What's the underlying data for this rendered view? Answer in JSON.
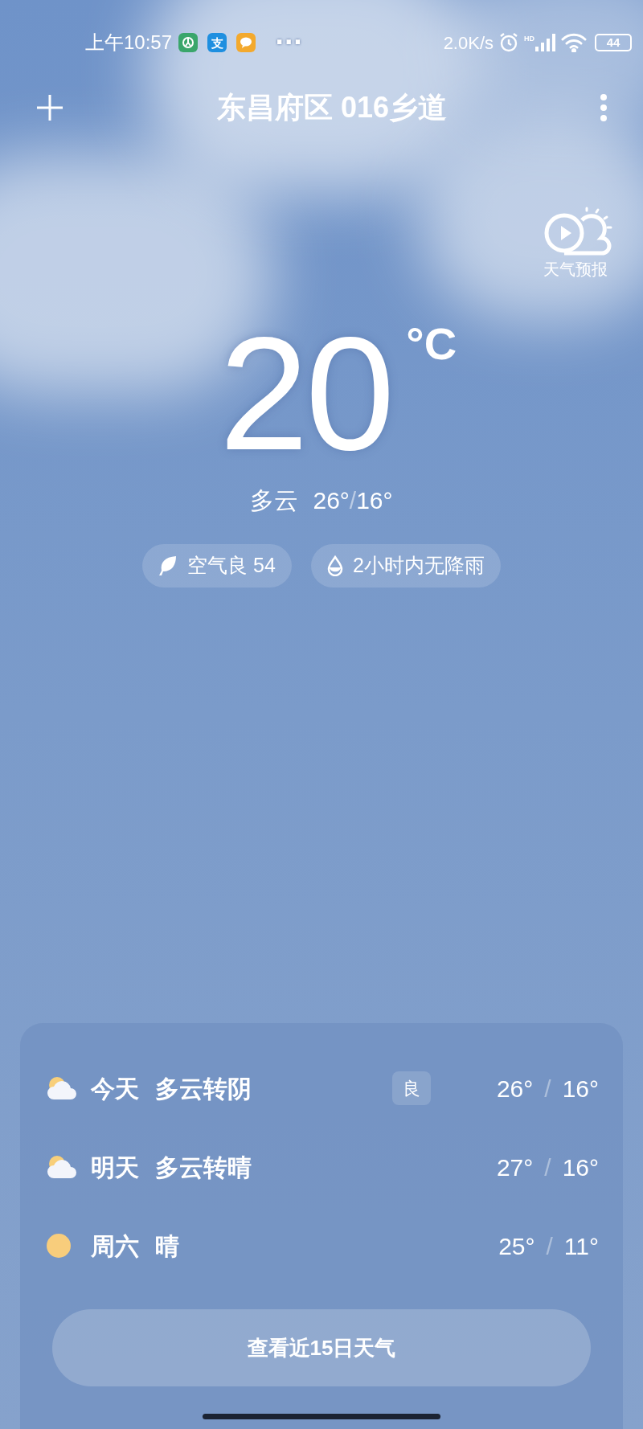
{
  "status_bar": {
    "time": "上午10:57",
    "notifications": [
      {
        "kind": "green"
      },
      {
        "kind": "alipay",
        "label": "支"
      },
      {
        "kind": "chat"
      }
    ],
    "more": "···",
    "speed": "2.0K/s",
    "hd": "HD",
    "battery": "44"
  },
  "header": {
    "title": "东昌府区 016乡道"
  },
  "forecast_video": {
    "label": "天气预报"
  },
  "current": {
    "temperature": "20",
    "unit": "°C",
    "condition": "多云",
    "high": "26°",
    "slash": "/",
    "low": "16°"
  },
  "chips": [
    {
      "kind": "leaf",
      "label": "空气良 54"
    },
    {
      "kind": "drop",
      "label": "2小时内无降雨"
    }
  ],
  "forecast": [
    {
      "kind": "cloudy-sun",
      "day": "今天",
      "condition": "多云转阴",
      "badge": "良",
      "high": "26°",
      "slash": "/",
      "low": "16°"
    },
    {
      "kind": "cloudy-sun",
      "day": "明天",
      "condition": "多云转晴",
      "high": "27°",
      "slash": "/",
      "low": "16°"
    },
    {
      "kind": "sun",
      "day": "周六",
      "condition": "晴",
      "high": "25°",
      "slash": "/",
      "low": "11°"
    }
  ],
  "more_button": "查看近15日天气"
}
